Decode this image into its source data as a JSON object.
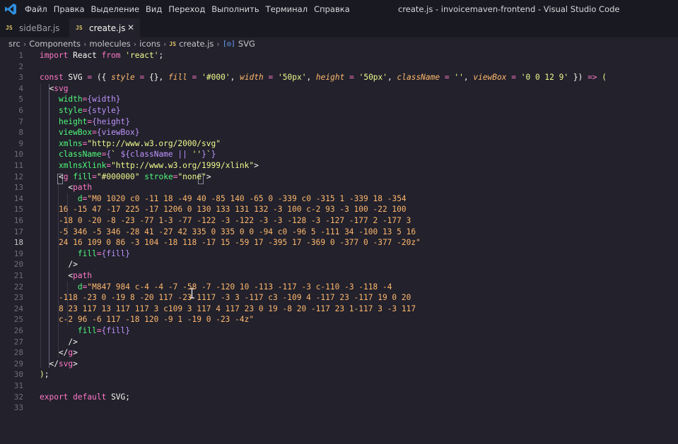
{
  "menu": [
    "Файл",
    "Правка",
    "Выделение",
    "Вид",
    "Переход",
    "Выполнить",
    "Терминал",
    "Справка"
  ],
  "window_title": "create.js - invoicemaven-frontend - Visual Studio Code",
  "tabs": [
    {
      "icon": "JS",
      "label": "sideBar.js"
    },
    {
      "icon": "JS",
      "label": "create.js",
      "close": "✕"
    }
  ],
  "breadcrumb": {
    "parts": [
      "src",
      "Components",
      "molecules",
      "icons"
    ],
    "file_icon": "JS",
    "file": "create.js",
    "symbol_icon": "[◎]",
    "symbol": "SVG",
    "separator": "›"
  },
  "colors": {
    "editor_bg": "#22212c",
    "keyword": "#ff79c6",
    "string": "#f1fa8c",
    "param": "#ffb86c",
    "function": "#50fa7b",
    "variable": "#bd93f9"
  },
  "active_line": 18,
  "lines": [
    [
      [
        "kw",
        "import"
      ],
      [
        "pun",
        " React "
      ],
      [
        "kw",
        "from"
      ],
      [
        "pun",
        " "
      ],
      [
        "str",
        "'react'"
      ],
      [
        "pun",
        ";"
      ]
    ],
    [],
    [
      [
        "kw",
        "const"
      ],
      [
        "pun",
        " SVG "
      ],
      [
        "kw",
        "="
      ],
      [
        "pun",
        " ("
      ],
      [
        "pun",
        "{ "
      ],
      [
        "prm",
        "style"
      ],
      [
        "pun",
        " "
      ],
      [
        "kw",
        "="
      ],
      [
        "pun",
        " {}, "
      ],
      [
        "prm",
        "fill"
      ],
      [
        "pun",
        " "
      ],
      [
        "kw",
        "="
      ],
      [
        "pun",
        " "
      ],
      [
        "str",
        "'#000'"
      ],
      [
        "pun",
        ", "
      ],
      [
        "prm",
        "width"
      ],
      [
        "pun",
        " "
      ],
      [
        "kw",
        "="
      ],
      [
        "pun",
        " "
      ],
      [
        "str",
        "'50px'"
      ],
      [
        "pun",
        ", "
      ],
      [
        "prm",
        "height"
      ],
      [
        "pun",
        " "
      ],
      [
        "kw",
        "="
      ],
      [
        "pun",
        " "
      ],
      [
        "str",
        "'50px'"
      ],
      [
        "pun",
        ", "
      ],
      [
        "prm",
        "className"
      ],
      [
        "pun",
        " "
      ],
      [
        "kw",
        "="
      ],
      [
        "pun",
        " "
      ],
      [
        "str",
        "''"
      ],
      [
        "pun",
        ", "
      ],
      [
        "prm",
        "viewBox"
      ],
      [
        "pun",
        " "
      ],
      [
        "kw",
        "="
      ],
      [
        "pun",
        " "
      ],
      [
        "str",
        "'0 0 12 9'"
      ],
      [
        "pun",
        " }) "
      ],
      [
        "kw",
        "=>"
      ],
      [
        "pun",
        " "
      ],
      [
        "brk",
        "("
      ]
    ],
    [
      [
        "pun",
        "  <"
      ],
      [
        "tag",
        "svg"
      ]
    ],
    [
      [
        "pun",
        "    "
      ],
      [
        "attr",
        "width"
      ],
      [
        "kw",
        "="
      ],
      [
        "pur",
        "{width}"
      ]
    ],
    [
      [
        "pun",
        "    "
      ],
      [
        "attr",
        "style"
      ],
      [
        "kw",
        "="
      ],
      [
        "pur",
        "{style}"
      ]
    ],
    [
      [
        "pun",
        "    "
      ],
      [
        "attr",
        "height"
      ],
      [
        "kw",
        "="
      ],
      [
        "pur",
        "{height}"
      ]
    ],
    [
      [
        "pun",
        "    "
      ],
      [
        "attr",
        "viewBox"
      ],
      [
        "kw",
        "="
      ],
      [
        "pur",
        "{viewBox}"
      ]
    ],
    [
      [
        "pun",
        "    "
      ],
      [
        "attr",
        "xmlns"
      ],
      [
        "kw",
        "="
      ],
      [
        "str",
        "\"http://www.w3.org/2000/svg\""
      ]
    ],
    [
      [
        "pun",
        "    "
      ],
      [
        "attr",
        "className"
      ],
      [
        "kw",
        "="
      ],
      [
        "pur",
        "{"
      ],
      [
        "str",
        "` "
      ],
      [
        "pur",
        "${className || "
      ],
      [
        "str",
        "''"
      ],
      [
        "pur",
        "}"
      ],
      [
        "str",
        "`"
      ],
      [
        "pur",
        "}"
      ]
    ],
    [
      [
        "pun",
        "    "
      ],
      [
        "attr",
        "xmlnsXlink"
      ],
      [
        "kw",
        "="
      ],
      [
        "str",
        "\"http://www.w3.org/1999/xlink\""
      ],
      [
        "pun",
        ">"
      ]
    ],
    [
      [
        "pun",
        "    <"
      ],
      [
        "tag",
        "g"
      ],
      [
        "pun",
        " "
      ],
      [
        "attr",
        "fill"
      ],
      [
        "kw",
        "="
      ],
      [
        "str",
        "\"#000000\""
      ],
      [
        "pun",
        " "
      ],
      [
        "attr",
        "stroke"
      ],
      [
        "kw",
        "="
      ],
      [
        "str",
        "\"none\""
      ],
      [
        "pun",
        ">"
      ]
    ],
    [
      [
        "pun",
        "      <"
      ],
      [
        "tag",
        "path"
      ]
    ],
    [
      [
        "pun",
        "        "
      ],
      [
        "attr",
        "d"
      ],
      [
        "kw",
        "="
      ],
      [
        "ora",
        "\"M0 1020 c0 -11 18 -49 40 -85 140 -65 0 -339 c0 -315 1 -339 18 -354"
      ]
    ],
    [
      [
        "ora",
        "    16 -15 47 -17 225 -17 1206 0 130 133 131 132 -3 100 c-2 93 -3 100 -22 100"
      ]
    ],
    [
      [
        "ora",
        "    -18 0 -20 -8 -23 -77 1-3 -77 -122 -3 -122 -3 -3 -128 -3 -127 -177 2 -177 3"
      ]
    ],
    [
      [
        "ora",
        "    -5 346 -5 346 -28 41 -27 42 335 0 335 0 0 -94 c0 -96 5 -111 34 -100 13 5 16"
      ]
    ],
    [
      [
        "ora",
        "    24 16 109 0 86 -3 104 -18 118 -17 15 -59 17 -395 17 -369 0 -377 0 -377 -20z\""
      ]
    ],
    [
      [
        "pun",
        "        "
      ],
      [
        "attr",
        "fill"
      ],
      [
        "kw",
        "="
      ],
      [
        "pur",
        "{fill}"
      ]
    ],
    [
      [
        "pun",
        "      />"
      ]
    ],
    [
      [
        "pun",
        "      <"
      ],
      [
        "tag",
        "path"
      ]
    ],
    [
      [
        "pun",
        "        "
      ],
      [
        "attr",
        "d"
      ],
      [
        "kw",
        "="
      ],
      [
        "ora",
        "\"M847 984 c-4 -4 -7 -58 -7 -120 10 -113 -117 -3 c-110 -3 -118 -4"
      ]
    ],
    [
      [
        "ora",
        "    -118 -23 0 -19 8 -20 117 -23 1117 -3 3 -117 c3 -109 4 -117 23 -117 19 0 20"
      ]
    ],
    [
      [
        "ora",
        "    8 23 117 13 117 117 3 c109 3 117 4 117 23 0 19 -8 20 -117 23 1-117 3 -3 117"
      ]
    ],
    [
      [
        "ora",
        "    c-2 96 -6 117 -18 120 -9 1 -19 0 -23 -4z\""
      ]
    ],
    [
      [
        "pun",
        "        "
      ],
      [
        "attr",
        "fill"
      ],
      [
        "kw",
        "="
      ],
      [
        "pur",
        "{fill}"
      ]
    ],
    [
      [
        "pun",
        "      />"
      ]
    ],
    [
      [
        "pun",
        "    </"
      ],
      [
        "tag",
        "g"
      ],
      [
        "pun",
        ">"
      ]
    ],
    [
      [
        "pun",
        "  </"
      ],
      [
        "tag",
        "svg"
      ],
      [
        "pun",
        ">"
      ]
    ],
    [
      [
        "brk",
        ")"
      ],
      [
        "pun",
        ";"
      ]
    ],
    [],
    [
      [
        "kw",
        "export"
      ],
      [
        "pun",
        " "
      ],
      [
        "kw",
        "default"
      ],
      [
        "pun",
        " SVG;"
      ]
    ],
    []
  ]
}
